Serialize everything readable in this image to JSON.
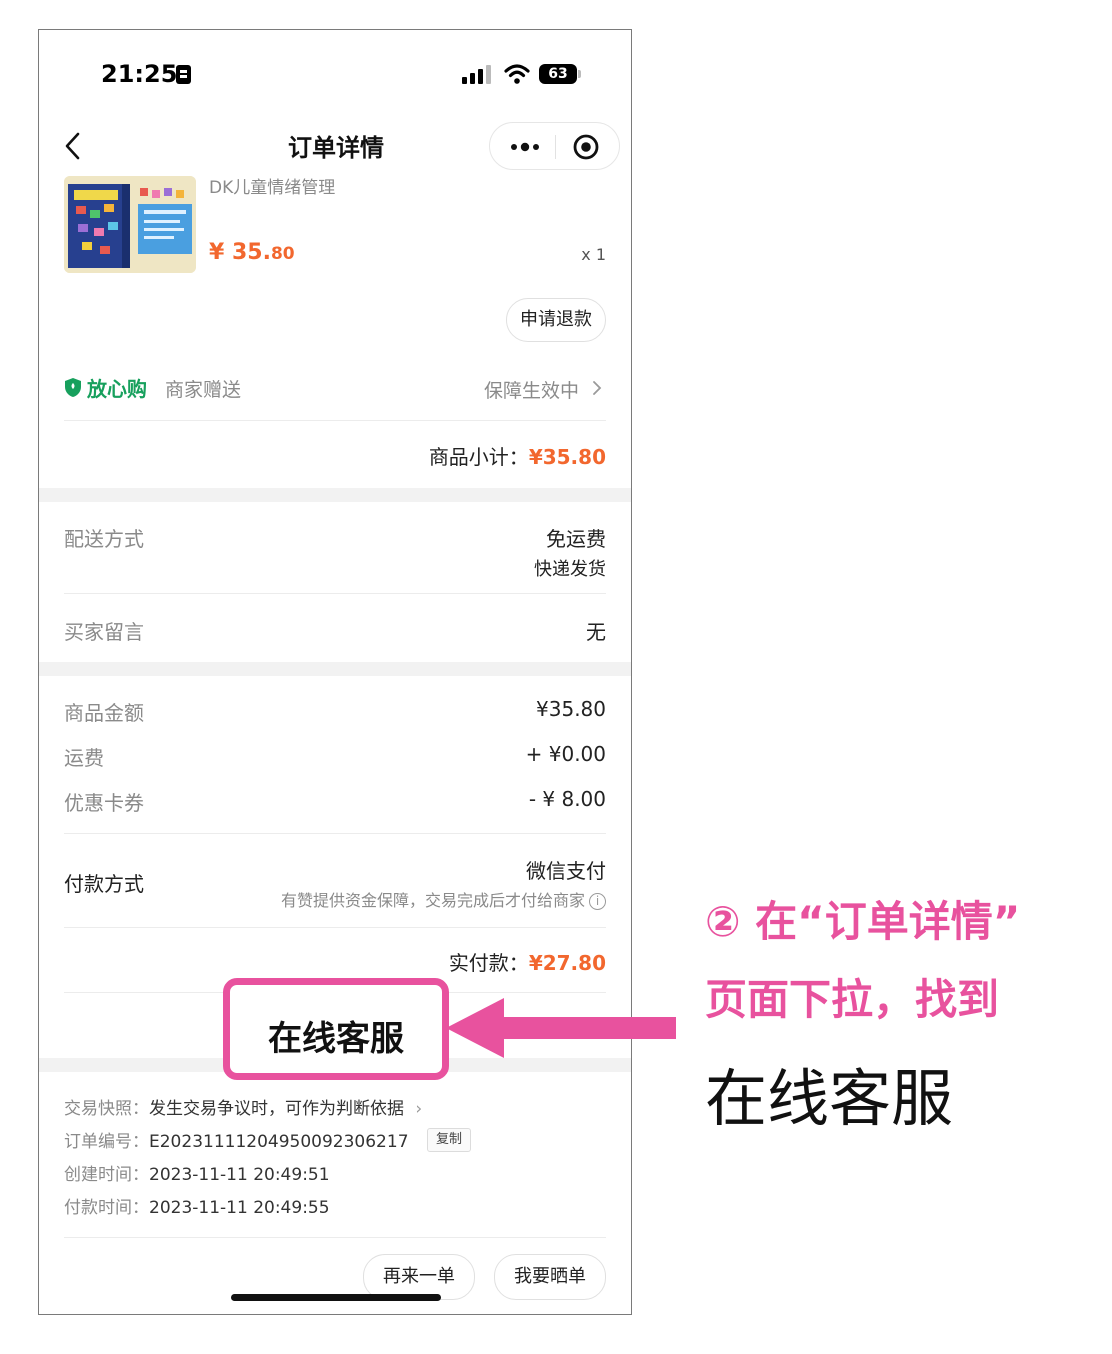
{
  "status_bar": {
    "time": "21:25",
    "battery": "63"
  },
  "nav": {
    "title": "订单详情"
  },
  "product": {
    "name": "DK儿童情绪管理",
    "price_symbol": "¥",
    "price_main": "35.",
    "price_cents": "80",
    "quantity": "x 1",
    "refund_label": "申请退款"
  },
  "assurance": {
    "name": "放心购",
    "gift": "商家赠送",
    "status": "保障生效中"
  },
  "subtotal": {
    "label": "商品小计：",
    "value": "¥35.80"
  },
  "delivery": {
    "label": "配送方式",
    "fee": "免运费",
    "method": "快递发货"
  },
  "message": {
    "label": "买家留言",
    "value": "无"
  },
  "costs": {
    "goods_label": "商品金额",
    "goods_value": "¥35.80",
    "shipping_label": "运费",
    "shipping_value": "+ ¥0.00",
    "coupon_label": "优惠卡券",
    "coupon_value": "- ¥ 8.00"
  },
  "payment": {
    "label": "付款方式",
    "method": "微信支付",
    "note": "有赞提供资金保障，交易完成后才付给商家"
  },
  "paid": {
    "label": "实付款：",
    "value": "¥27.80"
  },
  "service": {
    "label": "在线客服"
  },
  "order_meta": {
    "snapshot_label": "交易快照：",
    "snapshot_value": "发生交易争议时，可作为判断依据",
    "number_label": "订单编号：",
    "number_value": "E20231111204950092306217",
    "copy_label": "复制",
    "created_label": "创建时间：",
    "created_value": "2023-11-11 20:49:51",
    "paid_label": "付款时间：",
    "paid_value": "2023-11-11 20:49:55"
  },
  "actions": {
    "again": "再来一单",
    "share": "我要晒单"
  },
  "annotation": {
    "line1": "② 在“订单详情”",
    "line2": "页面下拉，找到",
    "line3": "在线客服"
  },
  "colors": {
    "accent_orange": "#f2672e",
    "assurance_green": "#17a05d",
    "annotation_pink": "#e8529e"
  }
}
